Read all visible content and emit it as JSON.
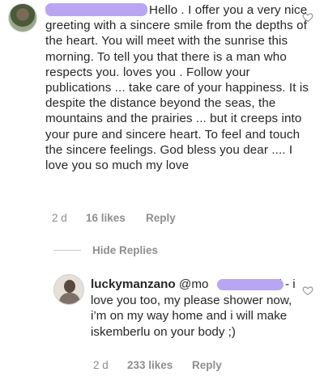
{
  "comment": {
    "text_parts": [
      "Hello . I offer you a very nice greeting with a sincere smile from the depths of the heart. You will meet with the sunrise this morning. To tell you that there is a man who respects you. loves you . Follow your publications ... take care of your happiness. It is despite the distance beyond the seas, the mountains and the prairies ... but it creeps into your pure and sincere heart. To feel and touch the sincere feelings. God bless you dear .... I love you so much my love"
    ],
    "time": "2 d",
    "likes": "16 likes",
    "reply_label": "Reply"
  },
  "hide_replies": {
    "label": "Hide Replies"
  },
  "reply": {
    "username": "luckymanzano",
    "mention_start": "@mo",
    "mention_end": "i",
    "text": " - i love you too, my please shower now, i’m on my way home and i will make iskemberlu on your body ;)",
    "time": "2 d",
    "likes": "233 likes",
    "reply_label": "Reply"
  },
  "icons": {
    "comment_like": "heart-outline-icon",
    "reply_like": "heart-outline-icon"
  },
  "colors": {
    "text": "#262626",
    "meta": "#8e8e8e",
    "redaction": "#b8a6f2"
  }
}
